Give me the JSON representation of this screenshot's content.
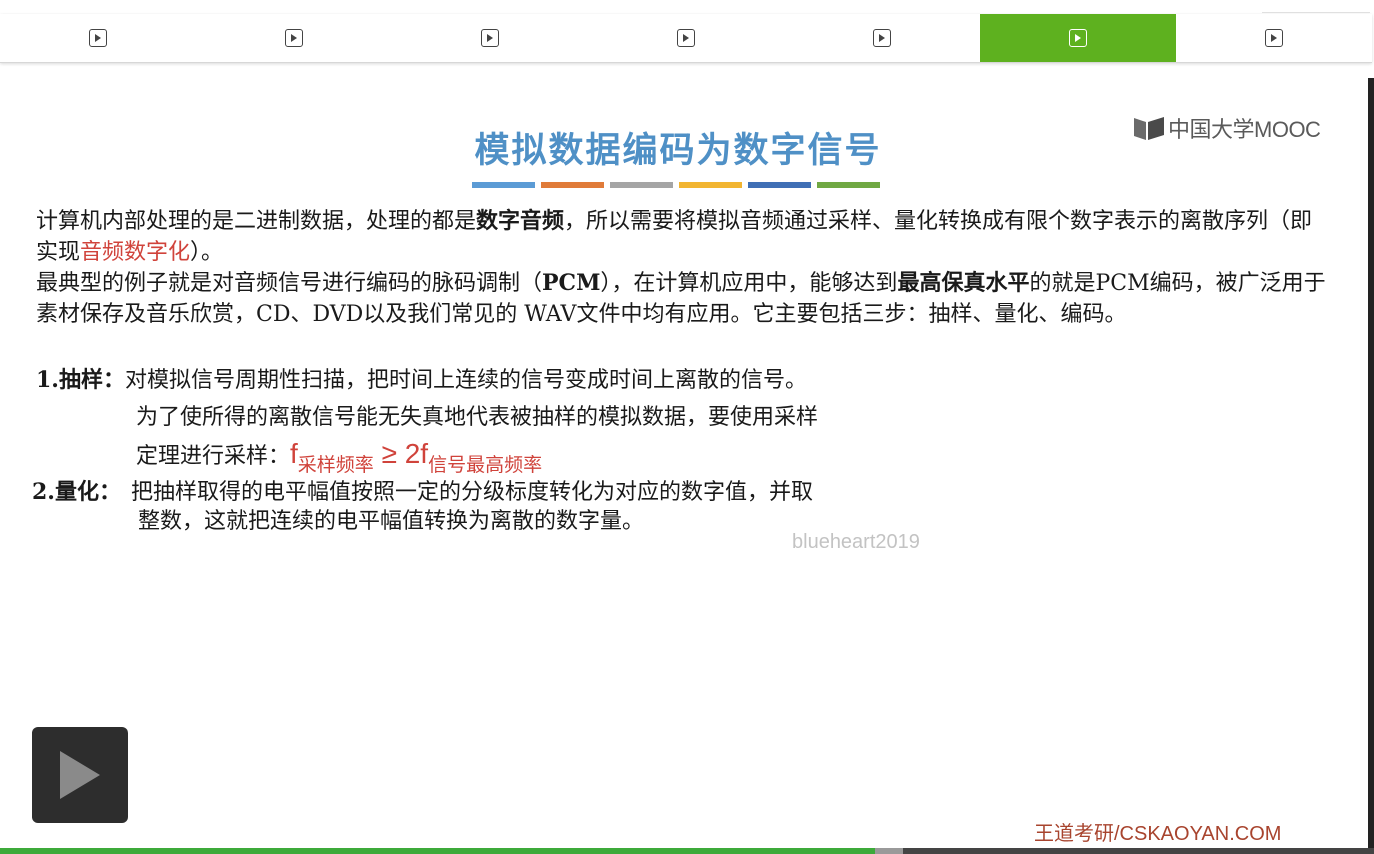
{
  "tabs": [
    {
      "icon": "play-square-icon",
      "active": false
    },
    {
      "icon": "play-square-icon",
      "active": false
    },
    {
      "icon": "play-square-icon",
      "active": false
    },
    {
      "icon": "play-square-icon",
      "active": false
    },
    {
      "icon": "play-square-icon",
      "active": false
    },
    {
      "icon": "play-square-icon",
      "active": true
    },
    {
      "icon": "play-square-icon",
      "active": false
    }
  ],
  "accent_color": "#5eb11f",
  "slide": {
    "logo_text": "中国大学MOOC",
    "title": "模拟数据编码为数字信号",
    "divider_colors": [
      "#5b9bd5",
      "#e07b39",
      "#a5a5a5",
      "#f2b531",
      "#3f6fb5",
      "#70a843"
    ],
    "para1": {
      "t1": "计算机内部处理的是二进制数据，处理的都是",
      "b1": "数字音频",
      "t2": "，所以需要将模拟音频通过采样、量化转换成有限个数字表示的离散序列（即实现",
      "r1": "音频数字化",
      "t3": "）。"
    },
    "para2": {
      "t1": "最典型的例子就是对音频信号进行编码的脉码调制（",
      "b1": "PCM",
      "t2": "），在计算机应用中，能够达到",
      "b2": "最高保真水平",
      "t3": "的就是PCM编码，被广泛用于素材保存及音乐欣赏，CD、DVD以及我们常见的 WAV文件中均有应用。它主要包括三步：抽样、量化、编码。"
    },
    "step1": {
      "label": "1.抽样：",
      "line1": "对模拟信号周期性扫描，把时间上连续的信号变成时间上离散的信号。",
      "line2": "为了使所得的离散信号能无失真地代表被抽样的模拟数据，要使用采样",
      "line3": "定理进行采样：",
      "f1": "f",
      "f1_sub": "采样频率",
      "op": " ≥ 2f",
      "f2_sub": "信号最高频率"
    },
    "step2": {
      "label": "2.量化：",
      "line1": "把抽样取得的电平幅值按照一定的分级标度转化为对应的数字值，并取",
      "line2": "整数，这就把连续的电平幅值转换为离散的数字量。"
    },
    "watermark": "blueheart2019",
    "footer": "王道考研/CSKAOYAN.COM"
  },
  "player": {
    "play_icon": "play-icon",
    "progress_fraction": 0.637,
    "buffered_fraction": 0.657
  }
}
